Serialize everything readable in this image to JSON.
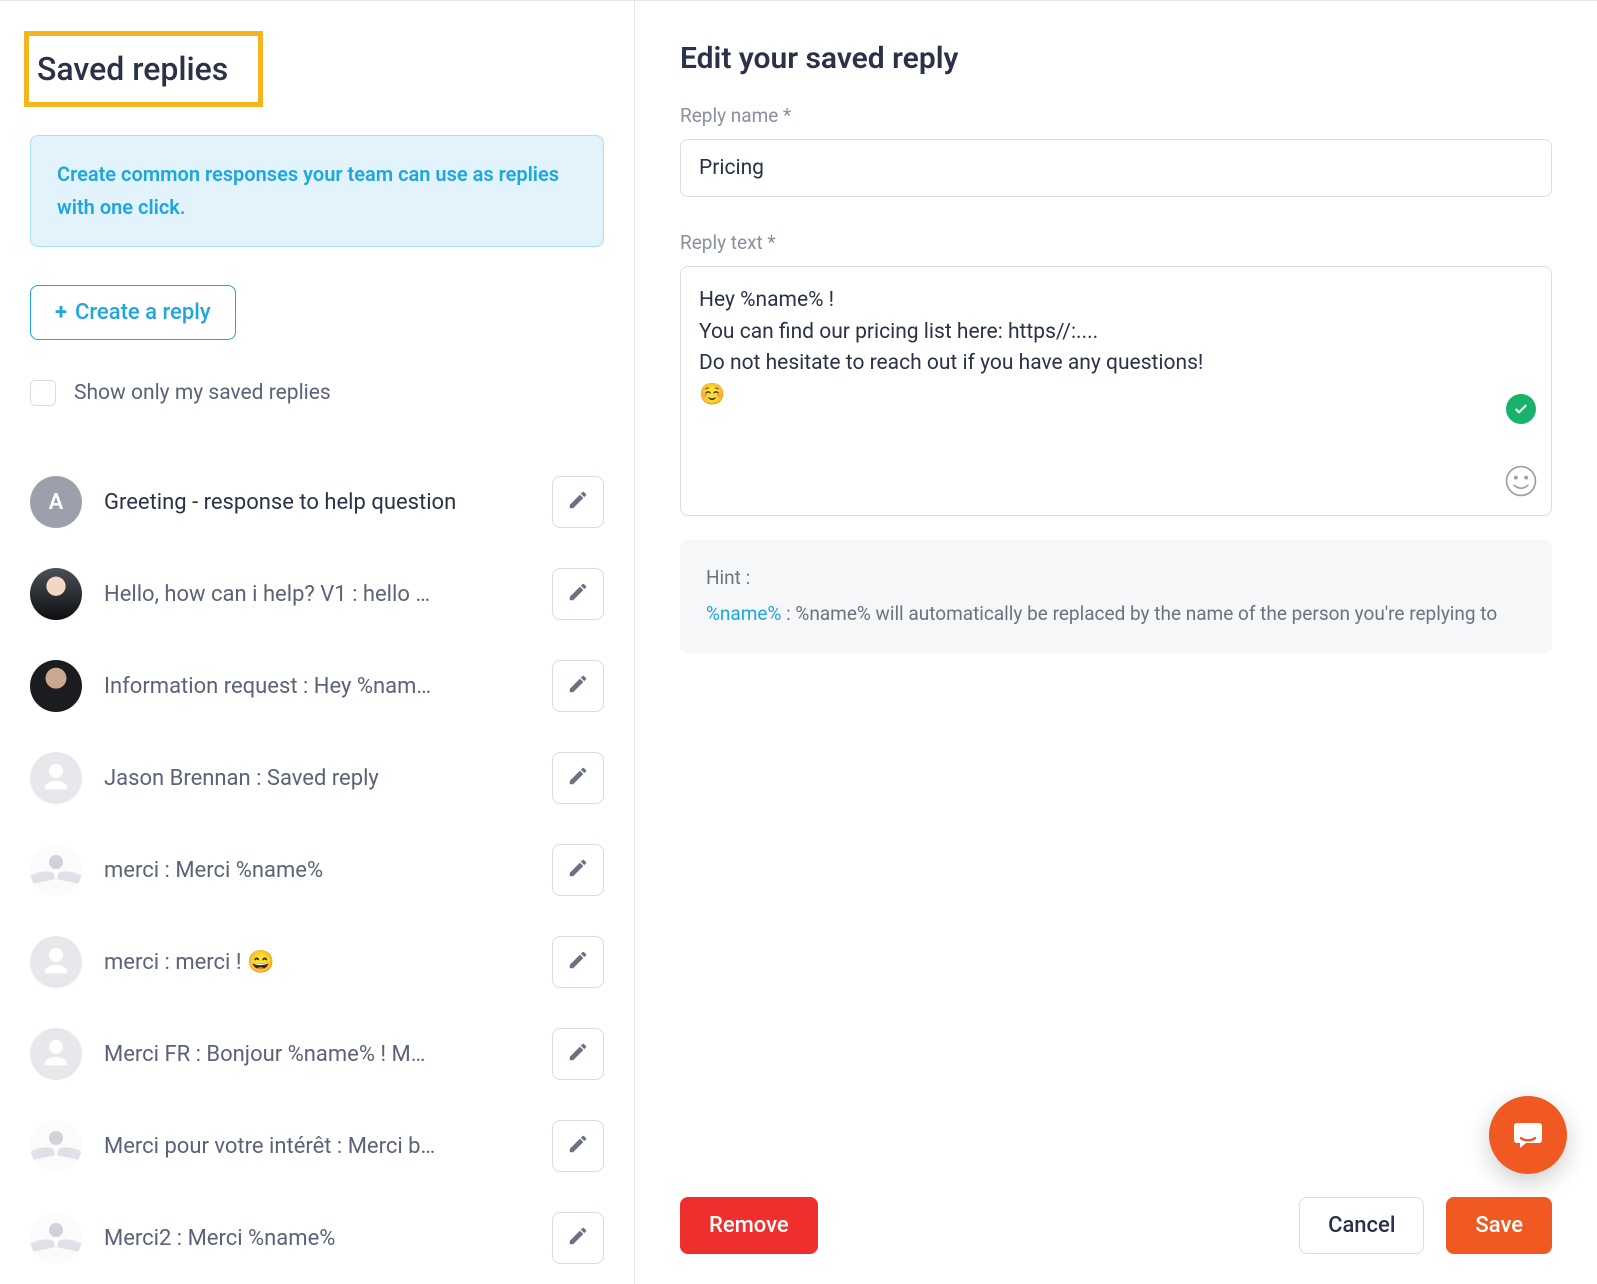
{
  "sidebar": {
    "title": "Saved replies",
    "banner": "Create common responses your team can use as replies with one click.",
    "create_label": "Create a reply",
    "show_mine_label": "Show only my saved replies",
    "items": [
      {
        "avatar": "letter",
        "letter": "A",
        "label": "Greeting - response to help question"
      },
      {
        "avatar": "photo1",
        "label": "Hello, how can i help? V1 : hello …"
      },
      {
        "avatar": "photo2",
        "label": "Information request : Hey %nam…"
      },
      {
        "avatar": "placeholder",
        "label": "Jason Brennan : Saved reply"
      },
      {
        "avatar": "wings",
        "label": "merci : Merci %name%"
      },
      {
        "avatar": "placeholder",
        "label": "merci : merci ! 😄"
      },
      {
        "avatar": "placeholder",
        "label": "Merci FR : Bonjour %name% ! M…"
      },
      {
        "avatar": "wings",
        "label": "Merci pour votre intérêt : Merci b…"
      },
      {
        "avatar": "wings",
        "label": "Merci2 : Merci %name%"
      }
    ]
  },
  "editor": {
    "heading": "Edit your saved reply",
    "name_label": "Reply name *",
    "name_value": "Pricing",
    "text_label": "Reply text *",
    "text_value": "Hey %name% !\nYou can find our pricing list here: https//:....\nDo not hesitate to reach out if you have any questions!\n☺️",
    "hint_title": "Hint :",
    "hint_var": "%name%",
    "hint_text": " : %name% will automatically be replaced by the name of the person you're replying to",
    "remove_label": "Remove",
    "cancel_label": "Cancel",
    "save_label": "Save"
  }
}
